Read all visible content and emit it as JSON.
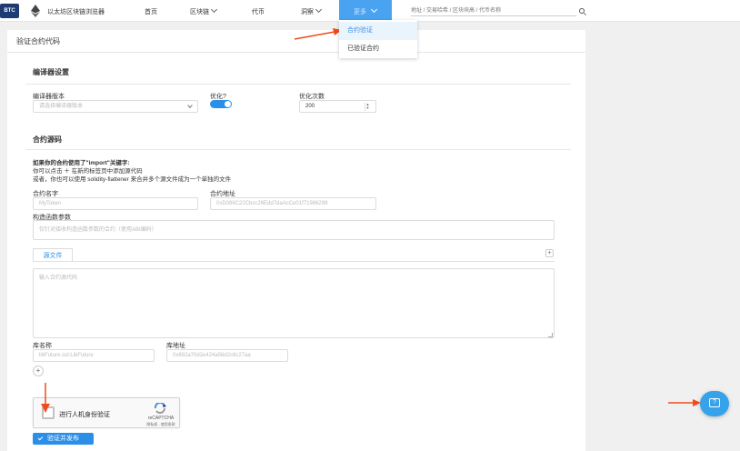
{
  "nav": {
    "logo": "BTC",
    "site_title": "以太坊区块链浏览器",
    "items": [
      {
        "label": "首页"
      },
      {
        "label": "区块链"
      },
      {
        "label": "代币"
      },
      {
        "label": "洞察"
      }
    ],
    "active_item": "更多",
    "search_placeholder": "地址 / 交易哈希 / 区块块高 / 代币名称"
  },
  "dropdown": {
    "items": [
      "合约验证",
      "已验证合约"
    ],
    "selected": "合约验证"
  },
  "page": {
    "card_title": "验证合约代码",
    "compiler_section": "编译器设置",
    "compiler_version_label": "编译器版本",
    "compiler_version_placeholder": "请选择编译器版本",
    "optimize_label": "优化?",
    "optimize_on": true,
    "runs_label": "优化次数",
    "runs_value": "200",
    "source_section": "合约源码",
    "import_title": "如果你的合约使用了\"import\"关键字:",
    "import_line1": "你可以点击 ＋ 在新的标签页中添加源代码",
    "import_line2": "或者，你也可以使用 solidity-flattener 来合并多个源文件成为一个单独的文件",
    "contract_name_label": "合约名字",
    "contract_name_placeholder": "MyToken",
    "contract_address_label": "合约地址",
    "contract_address_value": "0xD086C22Cbcc26Edd7daAcCe01f71986299",
    "constructor_label": "构造函数参数",
    "constructor_placeholder": "仅针对接收构造函数参数的合约（使用ABI编码）",
    "source_tab": "源文件",
    "source_placeholder": "输入合约源代码",
    "library_name_label": "库名称",
    "library_name_placeholder": "libFuture.sol:LibFuture",
    "library_address_label": "库地址",
    "library_address_placeholder": "0x692a70d2e424a56d2c6c27aa"
  },
  "recaptcha": {
    "label": "进行人机身份验证",
    "brand": "reCAPTCHA",
    "links": "隐私权 - 使用条款"
  },
  "submit_label": "验证并发布",
  "colors": {
    "accent": "#2b8fe8",
    "annotation_arrow": "#f04a1e",
    "nav_active": "#4aa3f0"
  }
}
